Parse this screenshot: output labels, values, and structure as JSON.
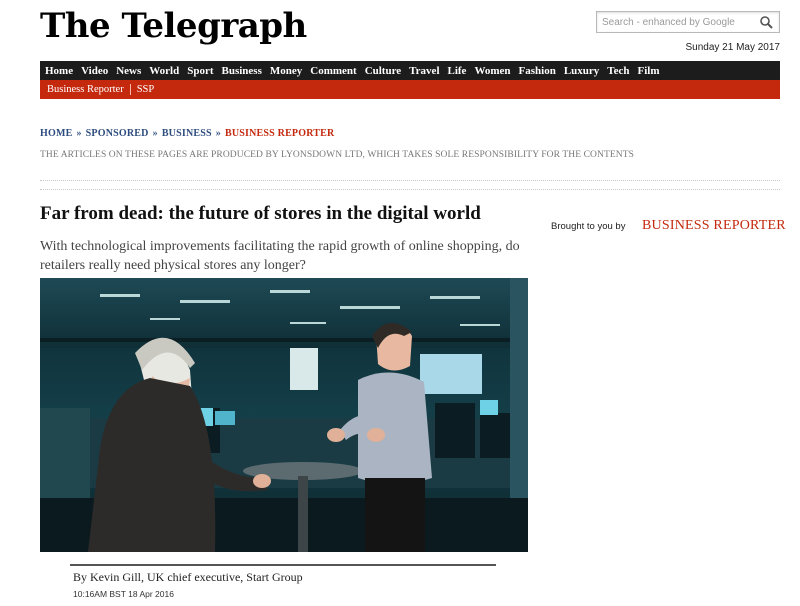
{
  "site": {
    "logo_text": "The Telegraph",
    "date": "Sunday 21 May 2017"
  },
  "search": {
    "placeholder": "Search - enhanced by Google",
    "icon": "magnifier-icon"
  },
  "nav": {
    "items": [
      "Home",
      "Video",
      "News",
      "World",
      "Sport",
      "Business",
      "Money",
      "Comment",
      "Culture",
      "Travel",
      "Life",
      "Women",
      "Fashion",
      "Luxury",
      "Tech",
      "Film"
    ]
  },
  "subnav": {
    "items": [
      "Business Reporter",
      "SSP"
    ]
  },
  "breadcrumb": {
    "items": [
      "HOME",
      "SPONSORED",
      "BUSINESS"
    ],
    "separator": "»",
    "current": "BUSINESS REPORTER"
  },
  "disclaimer": "THE ARTICLES ON THESE PAGES ARE PRODUCED BY LYONSDOWN LTD, WHICH TAKES SOLE RESPONSIBILITY FOR THE CONTENTS",
  "article": {
    "headline": "Far from dead: the future of stores in the digital world",
    "standfirst": "With technological improvements facilitating the rapid growth of online shopping, do retailers really need physical stores any longer?",
    "byline": "By Kevin Gill, UK chief executive, Start Group",
    "timestamp": "10:16AM BST 18 Apr 2016"
  },
  "sponsor": {
    "brought_by": "Brought to you by",
    "logo_text": "BUSINESS REPORTER"
  },
  "colors": {
    "nav_bg": "#1c1c1c",
    "accent_red": "#c4290e",
    "link_blue": "#2d4c7e"
  }
}
